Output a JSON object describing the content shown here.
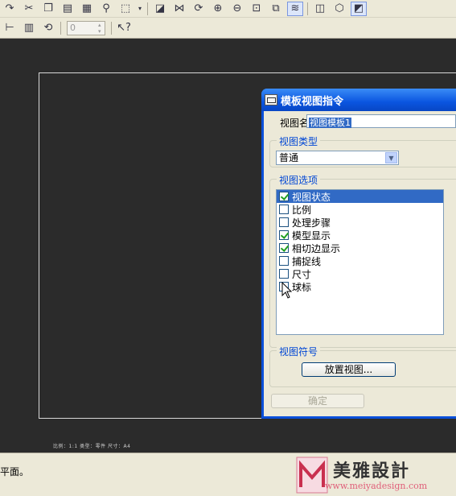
{
  "dialog": {
    "title": "模板视图指令",
    "name_label": "视图名称:",
    "name_value": "视图模板1",
    "type_group": "视图类型",
    "type_value": "普通",
    "options_group": "视图选项",
    "options": [
      {
        "label": "视图状态",
        "checked": true,
        "selected": true
      },
      {
        "label": "比例",
        "checked": false,
        "selected": false
      },
      {
        "label": "处理步骤",
        "checked": false,
        "selected": false
      },
      {
        "label": "模型显示",
        "checked": true,
        "selected": false
      },
      {
        "label": "相切边显示",
        "checked": true,
        "selected": false
      },
      {
        "label": "捕捉线",
        "checked": false,
        "selected": false
      },
      {
        "label": "尺寸",
        "checked": false,
        "selected": false
      },
      {
        "label": "球标",
        "checked": false,
        "selected": false
      }
    ],
    "symbol_group": "视图符号",
    "place_button": "放置视图...",
    "ok_button": "确定"
  },
  "status_info": "比例：1:1   类型：零件   尺寸：A4",
  "message": "平面。",
  "watermark": {
    "text": "美雅設計",
    "url": "www.meiyadesign.com"
  },
  "toolbar": {
    "spin_value": "0"
  },
  "colors": {
    "title_bar": "#0a55e0",
    "selection": "#316ac5",
    "canvas": "#2b2b2b",
    "group_title": "#0046d5"
  }
}
